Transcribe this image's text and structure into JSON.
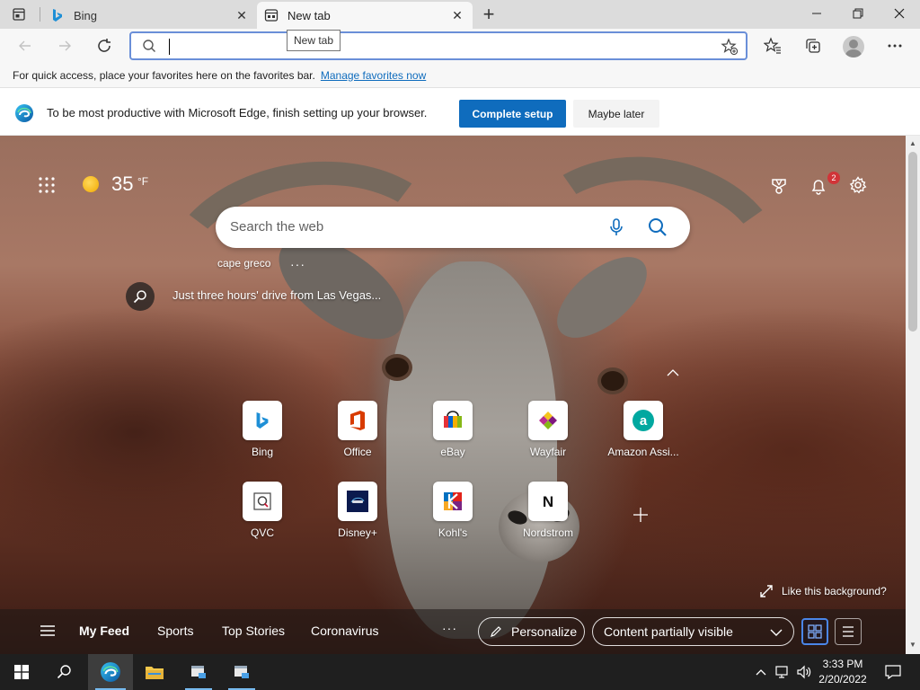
{
  "tabs": [
    {
      "title": "Bing",
      "icon": "bing-icon",
      "active": false
    },
    {
      "title": "New tab",
      "icon": "newtab-icon",
      "active": true
    }
  ],
  "tooltip": "New tab",
  "address": {
    "value": ""
  },
  "favorites_bar": {
    "message": "For quick access, place your favorites here on the favorites bar.",
    "link": "Manage favorites now"
  },
  "setup_banner": {
    "message": "To be most productive with Microsoft Edge, finish setting up your browser.",
    "primary": "Complete setup",
    "secondary": "Maybe later"
  },
  "weather": {
    "temp": "35",
    "unit": "°F"
  },
  "notifications": {
    "count": "2"
  },
  "search": {
    "placeholder": "Search the web"
  },
  "trending": {
    "query": "cape greco",
    "more": "···"
  },
  "background": {
    "info": "Just three hours' drive from Las Vegas...",
    "like": "Like this background?"
  },
  "quick_links": [
    {
      "label": "Bing",
      "icon": "bing-icon"
    },
    {
      "label": "Office",
      "icon": "office-icon"
    },
    {
      "label": "eBay",
      "icon": "ebay-icon"
    },
    {
      "label": "Wayfair",
      "icon": "wayfair-icon"
    },
    {
      "label": "Amazon Assi...",
      "icon": "amazon-assistant-icon"
    },
    {
      "label": "QVC",
      "icon": "qvc-icon"
    },
    {
      "label": "Disney+",
      "icon": "disney-plus-icon"
    },
    {
      "label": "Kohl's",
      "icon": "kohls-icon"
    },
    {
      "label": "Nordstrom",
      "icon": "nordstrom-icon"
    }
  ],
  "feed": {
    "items": [
      "My Feed",
      "Sports",
      "Top Stories",
      "Coronavirus"
    ],
    "more": "···",
    "personalize": "Personalize",
    "visibility": "Content partially visible"
  },
  "clock": {
    "time": "3:33 PM",
    "date": "2/20/2022"
  },
  "colors": {
    "accent": "#0f6cbd",
    "badge": "#d13438",
    "taskbar": "#1f1f1f"
  }
}
